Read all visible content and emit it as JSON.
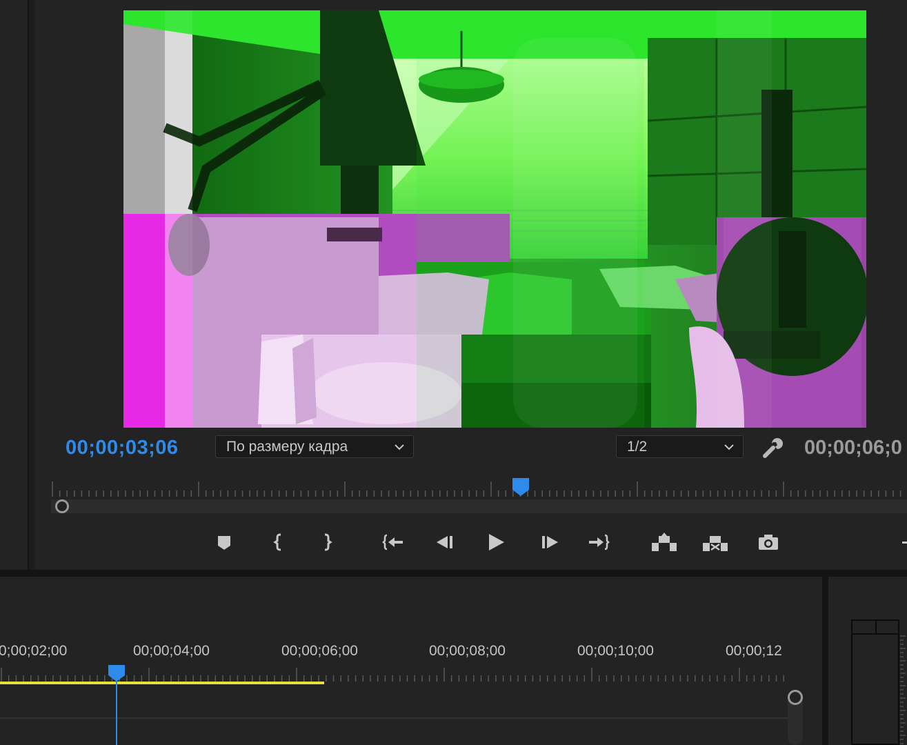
{
  "monitor": {
    "current_timecode": "00;00;03;06",
    "duration_timecode": "00;00;06;0",
    "zoom_dropdown": {
      "selected": "По размеру кадра"
    },
    "resolution_dropdown": {
      "selected": "1/2"
    },
    "playback_position_fraction": 0.55
  },
  "transport": [
    {
      "name": "add-marker-button",
      "icon": "marker-icon"
    },
    {
      "name": "mark-in-button",
      "icon": "mark-in-icon"
    },
    {
      "name": "mark-out-button",
      "icon": "mark-out-icon"
    },
    {
      "name": "go-to-in-button",
      "icon": "go-to-in-icon"
    },
    {
      "name": "step-back-button",
      "icon": "step-back-icon"
    },
    {
      "name": "play-button",
      "icon": "play-icon"
    },
    {
      "name": "step-forward-button",
      "icon": "step-forward-icon"
    },
    {
      "name": "go-to-out-button",
      "icon": "go-to-out-icon"
    },
    {
      "name": "lift-button",
      "icon": "lift-icon"
    },
    {
      "name": "extract-button",
      "icon": "extract-icon"
    },
    {
      "name": "export-frame-button",
      "icon": "camera-icon"
    }
  ],
  "timeline": {
    "ruler_labels": [
      "0;00;02;00",
      "00;00;04;00",
      "00;00;06;00",
      "00;00;08;00",
      "00;00;10;00",
      "00;00;12"
    ]
  },
  "colors": {
    "accent_blue": "#2d8ceb",
    "work_area_yellow": "#e6e03a",
    "panel_bg": "#232323",
    "overlay_green": "#1fe01f",
    "overlay_magenta": "#e020e0"
  }
}
